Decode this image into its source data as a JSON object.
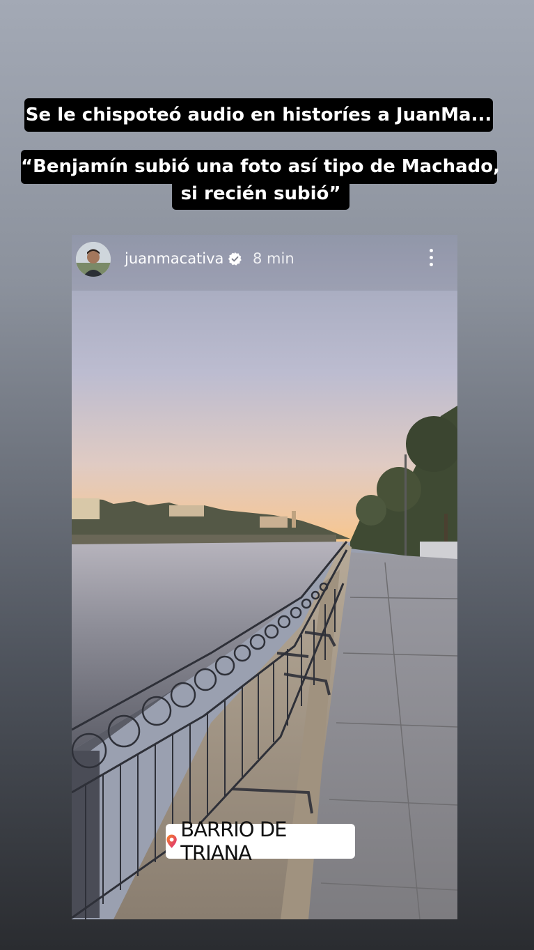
{
  "captions": {
    "line1": "Se le chispoteó audio en historíes a JuanMa...",
    "line2a": "“Benjamín subió una foto así tipo de Machado,",
    "line2b": "si recién subió”"
  },
  "story": {
    "username": "juanmacativa",
    "time": "8 min",
    "icons": [
      "avatar",
      "verified-badge-icon",
      "more-options-icon",
      "location-pin-icon"
    ],
    "location_sticker": "BARRIO DE TRIANA"
  },
  "colors": {
    "caption_bg": "#000000",
    "caption_text": "#ffffff",
    "pin_gradient": [
      "#f58529",
      "#dd2a7b"
    ]
  }
}
